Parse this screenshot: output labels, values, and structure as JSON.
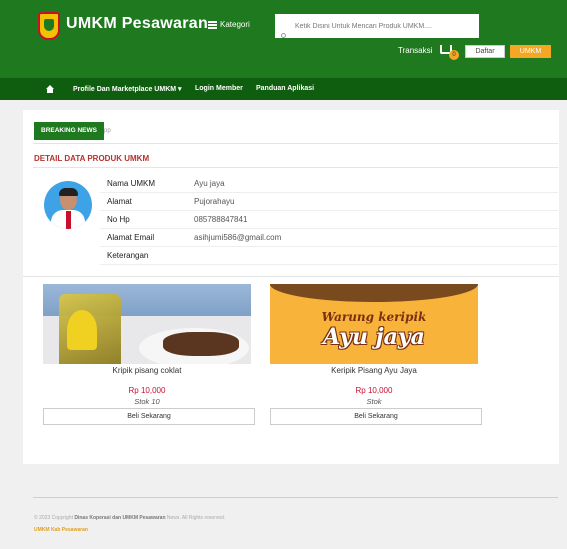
{
  "header": {
    "brand": "UMKM Pesawaran",
    "kategori": "Kategori",
    "search_placeholder": "Ketik Disini Untuk Mencari Produk UMKM....",
    "transaksi": "Transaksi",
    "cart_count": "0",
    "daftar": "Daftar",
    "umkm": "UMKM"
  },
  "nav": {
    "items": [
      "Profile Dan Marketplace UMKM ▾",
      "Login Member",
      "Panduan Aplikasi"
    ]
  },
  "breaking": {
    "tag": "BREAKING NEWS",
    "text": "pp"
  },
  "detail": {
    "title": "DETAIL DATA PRODUK UMKM",
    "rows": [
      {
        "label": "Nama UMKM",
        "value": "Ayu jaya"
      },
      {
        "label": "Alamat",
        "value": "Pujorahayu"
      },
      {
        "label": "No Hp",
        "value": "085788847841"
      },
      {
        "label": "Alamat Email",
        "value": "asihjumi586@gmail.com"
      },
      {
        "label": "Keterangan",
        "value": ""
      }
    ]
  },
  "products": [
    {
      "name": "Kripik pisang coklat",
      "price": "Rp 10,000",
      "stock": "Stok 10",
      "button": "Beli Sekarang"
    },
    {
      "name": "Keripik Pisang Ayu Jaya",
      "price": "Rp 10,000",
      "stock": "Stok",
      "button": "Beli Sekarang",
      "banner_top": "Warung keripik",
      "banner_main": "Ayu jaya"
    }
  ],
  "footer": {
    "copyright_prefix": "© 2023 Copyright",
    "copyright_org": "Dinas Koperasi dan UMKM Pesawaran",
    "copyright_suffix": "News. All Rights reserved.",
    "link": "UMKM Kab Pesawaran"
  },
  "colors": {
    "primary_green": "#1f7a1f",
    "nav_green": "#0f5e0f",
    "accent_orange": "#f5a623",
    "title_red": "#b5322d",
    "price_red": "#c8102e"
  }
}
